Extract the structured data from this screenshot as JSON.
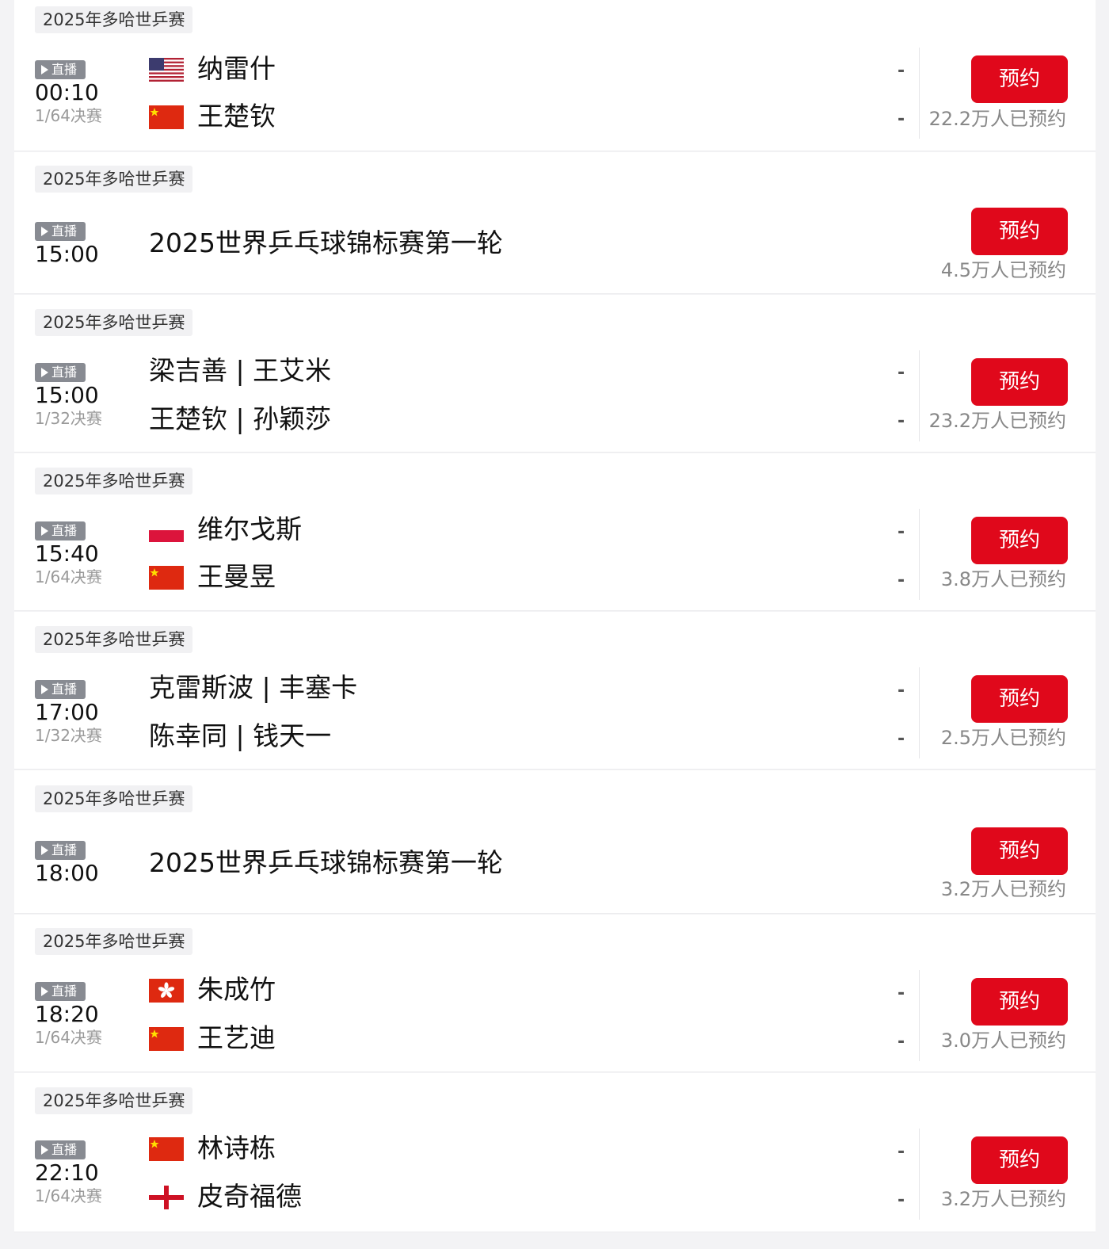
{
  "colors": {
    "accent": "#e0081b",
    "live_badge": "#888b92",
    "card_bg": "#ffffff",
    "page_bg": "#f3f3f5"
  },
  "live_label": "直播",
  "book_label": "预约",
  "matches": [
    {
      "tag": "2025年多哈世乒赛",
      "time": "00:10",
      "round": "1/64决赛",
      "players": [
        {
          "name": "纳雷什",
          "flag": "us-flag"
        },
        {
          "name": "王楚钦",
          "flag": "cn-flag"
        }
      ],
      "scores": [
        "-",
        "-"
      ],
      "bookings": "22.2万人已预约"
    },
    {
      "tag": "2025年多哈世乒赛",
      "time": "15:00",
      "title": "2025世界乒乓球锦标赛第一轮",
      "bookings": "4.5万人已预约"
    },
    {
      "tag": "2025年多哈世乒赛",
      "time": "15:00",
      "round": "1/32决赛",
      "players": [
        {
          "name": "梁吉善 | 王艾米"
        },
        {
          "name": "王楚钦 | 孙颖莎"
        }
      ],
      "scores": [
        "-",
        "-"
      ],
      "bookings": "23.2万人已预约"
    },
    {
      "tag": "2025年多哈世乒赛",
      "time": "15:40",
      "round": "1/64决赛",
      "players": [
        {
          "name": "维尔戈斯",
          "flag": "pl-flag"
        },
        {
          "name": "王曼昱",
          "flag": "cn-flag"
        }
      ],
      "scores": [
        "-",
        "-"
      ],
      "bookings": "3.8万人已预约"
    },
    {
      "tag": "2025年多哈世乒赛",
      "time": "17:00",
      "round": "1/32决赛",
      "players": [
        {
          "name": "克雷斯波 | 丰塞卡"
        },
        {
          "name": "陈幸同 | 钱天一"
        }
      ],
      "scores": [
        "-",
        "-"
      ],
      "bookings": "2.5万人已预约"
    },
    {
      "tag": "2025年多哈世乒赛",
      "time": "18:00",
      "title": "2025世界乒乓球锦标赛第一轮",
      "bookings": "3.2万人已预约"
    },
    {
      "tag": "2025年多哈世乒赛",
      "time": "18:20",
      "round": "1/64决赛",
      "players": [
        {
          "name": "朱成竹",
          "flag": "hk-flag"
        },
        {
          "name": "王艺迪",
          "flag": "cn-flag"
        }
      ],
      "scores": [
        "-",
        "-"
      ],
      "bookings": "3.0万人已预约"
    },
    {
      "tag": "2025年多哈世乒赛",
      "time": "22:10",
      "round": "1/64决赛",
      "players": [
        {
          "name": "林诗栋",
          "flag": "cn-flag"
        },
        {
          "name": "皮奇福德",
          "flag": "en-flag"
        }
      ],
      "scores": [
        "-",
        "-"
      ],
      "bookings": "3.2万人已预约"
    }
  ]
}
